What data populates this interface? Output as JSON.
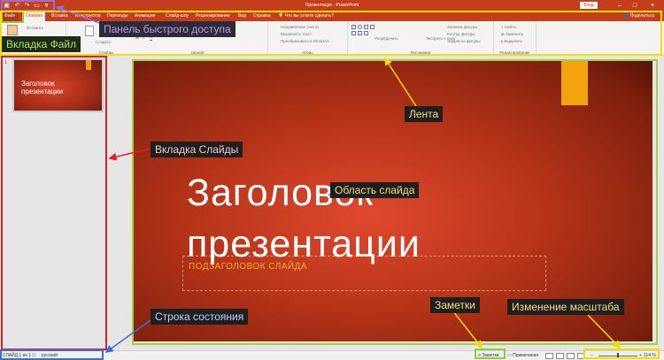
{
  "titlebar": {
    "title": "Презентация - PowerPoint",
    "login": "Вход",
    "qat_icons": [
      "save-icon",
      "undo-icon",
      "redo-icon",
      "start-from-beginning-icon",
      "customize-arrow-icon"
    ]
  },
  "tabs": {
    "items": [
      "Файл",
      "Главная",
      "Вставка",
      "Конструктор",
      "Переходы",
      "Анимация",
      "Слайд-шоу",
      "Рецензирование",
      "Вид",
      "Справка"
    ],
    "tell_me": "Что вы хотите сделать?",
    "share": "Поделиться"
  },
  "ribbon": {
    "groups": [
      "Слайды",
      "Шрифт",
      "Абзац",
      "Рисование",
      "Редактирование"
    ],
    "font_items": [
      "Вставить",
      "Создать"
    ],
    "paragraph_items": [
      "Направление текста",
      "Выровнять текст",
      "Преобразовать в SmartArt"
    ],
    "drawing_items": [
      "Упорядочить",
      "Экспресс-стили",
      "Заливка фигуры",
      "Контур фигуры",
      "Эффекты фигуры"
    ],
    "editing_items": [
      "Найти",
      "Заменить",
      "Выделить"
    ]
  },
  "slides_pane": {
    "slide_number": "1",
    "thumb_title": "Заголовок презентации"
  },
  "slide": {
    "title": "Заголовок презентации",
    "subtitle": "ПОДЗАГОЛОВОК СЛАЙДА"
  },
  "statusbar": {
    "slide_info": "СЛАЙД 1 из 1",
    "language": "русский",
    "notes": "Заметки",
    "comments": "Примечания",
    "zoom": "114 %"
  },
  "annotations": {
    "qat": "Панель быстрого доступа",
    "file_tab": "Вкладка Файл",
    "ribbon": "Лента",
    "slides_tab": "Вкладка Слайды",
    "slide_area": "Область слайда",
    "status_bar": "Строка состояния",
    "notes": "Заметки",
    "zoom": "Изменение масштаба"
  },
  "colors": {
    "brand": "#c43e1c",
    "accent_orange": "#f3a30e",
    "annot_yellow": "#f2df00",
    "annot_red": "#e02020",
    "annot_blue": "#3a6fd8",
    "annot_violet": "#9b6bd6",
    "annot_green": "#8fce3a"
  }
}
